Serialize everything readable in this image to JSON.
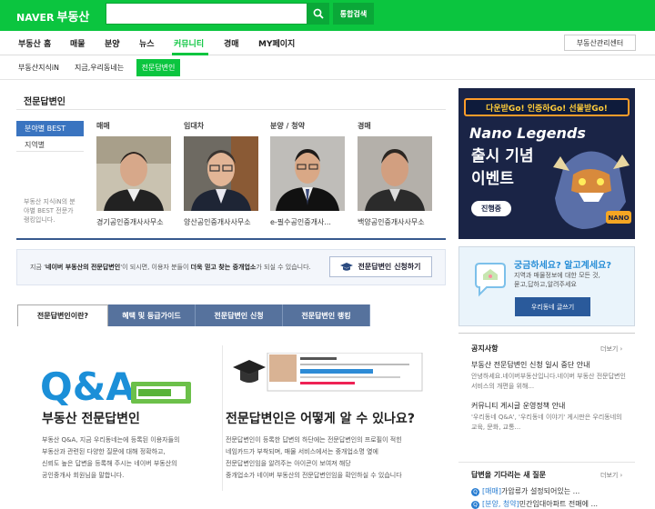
{
  "header": {
    "logo": "NAVER",
    "service": "부동산",
    "search_value": "",
    "search_button": "통합검색"
  },
  "gnb": {
    "items": [
      "부동산 홈",
      "매물",
      "분양",
      "뉴스",
      "커뮤니티",
      "경매",
      "MY페이지"
    ],
    "center_button": "부동산관리센터"
  },
  "lnb": {
    "items": [
      "부동산지식iN",
      "지금,우리동네는",
      "전문답변인"
    ]
  },
  "section": {
    "title": "전문답변인",
    "left_tabs": [
      "분야별 BEST",
      "지역별"
    ],
    "left_note": "부동산 지식iN의 분야별 BEST 전문가 랭킹입니다.",
    "experts": [
      {
        "category": "매매",
        "caption": "경기공인중개사사무소"
      },
      {
        "category": "임대차",
        "caption": "양산공인중개사사무소"
      },
      {
        "category": "분양 / 청약",
        "caption": "e-필수공인중개사..."
      },
      {
        "category": "경매",
        "caption": "백양공인중개사사무소"
      }
    ]
  },
  "info": {
    "prefix": "지금 '",
    "highlight": "네이버 부동산의 전문답변인",
    "middle": "'이 되시면, 이용자 분들이 ",
    "bold": "더욱 믿고 찾는 중개업소",
    "suffix": "가 되실 수 있습니다.",
    "apply_button": "전문답변인 신청하기"
  },
  "tabs": [
    "전문답변인이란?",
    "혜택 및 등급가이드",
    "전문답변인 신청",
    "전문답변인 랭킹"
  ],
  "panel": {
    "left_title": "부동산 전문답변인",
    "left_lines": [
      "부동산 Q&A, 지금 우리동네는에 등록된 이용자들의",
      "부동산과 관련된 다양한 질문에 대해 정확하고,",
      "신뢰도 높은 답변을 등록해 주시는 네이버 부동산의",
      "공인중개사 회원님을 말합니다."
    ],
    "right_title": "전문답변인은 어떻게 알 수 있나요?",
    "right_lines": [
      "전문답변인이 등록한 답변의 하단에는 전문답변인의 프로필이 적힌",
      "네임카드가 부착되며, 매물 서비스에서는 중개업소명 옆에",
      "전문답변인임을 알려주는 아이콘이 보여져 해당",
      "중개업소가 네이버 부동산의 전문답변인임을 확인하실 수 있습니다"
    ],
    "qa_text": "Q&A"
  },
  "ad": {
    "top": "다운받Go! 인증하Go! 선물받Go!",
    "title": "Nano Legends",
    "line1": "출시 기념",
    "line2": "이벤트",
    "button": "진행중",
    "brand": "NANO"
  },
  "dongnae": {
    "title": "궁금하세요? 알고계세요?",
    "lines": [
      "지역과 매물정보에 대한 모든 것,",
      "묻고,답하고,알려주세요"
    ],
    "button": "우리동네 글쓰기"
  },
  "notice": {
    "title": "공지사항",
    "more": "더보기 ›",
    "items": [
      {
        "title": "부동산 전문답변인 신청 일시 중단 안내",
        "desc": "안녕하세요.네이버부동산입니다.네이버 부동산 전문답변인 서비스의 개편을 위해..."
      },
      {
        "title": "커뮤니티 게시글 운영정책 안내",
        "desc": "'우리동네 Q&A', '우리동네 이야기' 게시판은 우리동네의 교육, 문화, 교통..."
      }
    ]
  },
  "questions": {
    "title": "답변을 기다리는 새 질문",
    "more": "더보기 ›",
    "items": [
      {
        "tag": "[매매]",
        "text": "가압류가 설정되어있는 ..."
      },
      {
        "tag": "[분양, 청약]",
        "text": "민간임대아파트 전매에 ..."
      }
    ]
  },
  "colors": {
    "naver_green": "#0bc53f",
    "navy": "#37598e",
    "tab_blue": "#56729d"
  }
}
